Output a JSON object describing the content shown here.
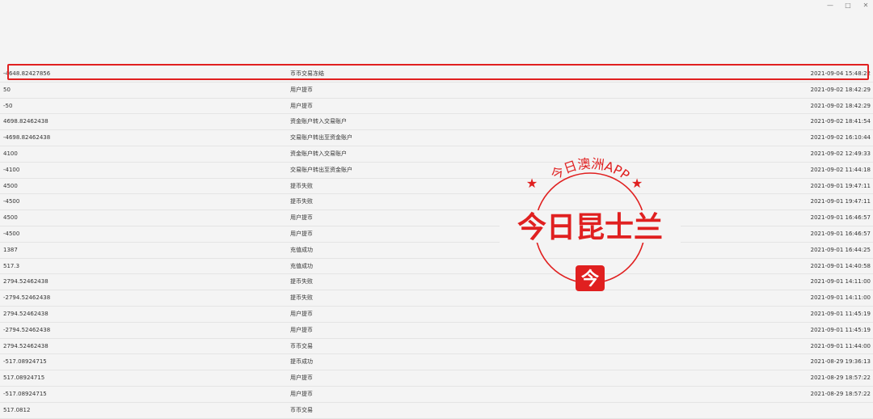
{
  "window": {
    "minimize_icon": "minimize-icon",
    "maximize_icon": "maximize-icon",
    "close_icon": "close-icon"
  },
  "records": [
    {
      "amount": "-4648.82427856",
      "type": "币币交易冻结",
      "time": "2021-09-04 15:48:22"
    },
    {
      "amount": "50",
      "type": "用户提币",
      "time": "2021-09-02 18:42:29"
    },
    {
      "amount": "-50",
      "type": "用户提币",
      "time": "2021-09-02 18:42:29"
    },
    {
      "amount": "4698.82462438",
      "type": "资金账户转入交易账户",
      "time": "2021-09-02 18:41:54"
    },
    {
      "amount": "-4698.82462438",
      "type": "交易账户转出至资金账户",
      "time": "2021-09-02 16:10:44"
    },
    {
      "amount": "4100",
      "type": "资金账户转入交易账户",
      "time": "2021-09-02 12:49:33"
    },
    {
      "amount": "-4100",
      "type": "交易账户转出至资金账户",
      "time": "2021-09-02 11:44:18"
    },
    {
      "amount": "4500",
      "type": "提币失败",
      "time": "2021-09-01 19:47:11"
    },
    {
      "amount": "-4500",
      "type": "提币失败",
      "time": "2021-09-01 19:47:11"
    },
    {
      "amount": "4500",
      "type": "用户提币",
      "time": "2021-09-01 16:46:57"
    },
    {
      "amount": "-4500",
      "type": "用户提币",
      "time": "2021-09-01 16:46:57"
    },
    {
      "amount": "1387",
      "type": "充值成功",
      "time": "2021-09-01 16:44:25"
    },
    {
      "amount": "517.3",
      "type": "充值成功",
      "time": "2021-09-01 14:40:58"
    },
    {
      "amount": "2794.52462438",
      "type": "提币失败",
      "time": "2021-09-01 14:11:00"
    },
    {
      "amount": "-2794.52462438",
      "type": "提币失败",
      "time": "2021-09-01 14:11:00"
    },
    {
      "amount": "2794.52462438",
      "type": "用户提币",
      "time": "2021-09-01 11:45:19"
    },
    {
      "amount": "-2794.52462438",
      "type": "用户提币",
      "time": "2021-09-01 11:45:19"
    },
    {
      "amount": "2794.52462438",
      "type": "币币交易",
      "time": "2021-09-01 11:44:00"
    },
    {
      "amount": "-517.08924715",
      "type": "提币成功",
      "time": "2021-08-29 19:36:13"
    },
    {
      "amount": "517.08924715",
      "type": "用户提币",
      "time": "2021-08-29 18:57:22"
    },
    {
      "amount": "-517.08924715",
      "type": "用户提币",
      "time": "2021-08-29 18:57:22"
    },
    {
      "amount": "517.0812",
      "type": "币币交易",
      "time": ""
    }
  ],
  "watermark": {
    "arc_text": "今日澳洲APP",
    "main_text": "今日昆士兰",
    "logo_char": "今",
    "color": "#e02020"
  },
  "highlight_color": "#e02020"
}
